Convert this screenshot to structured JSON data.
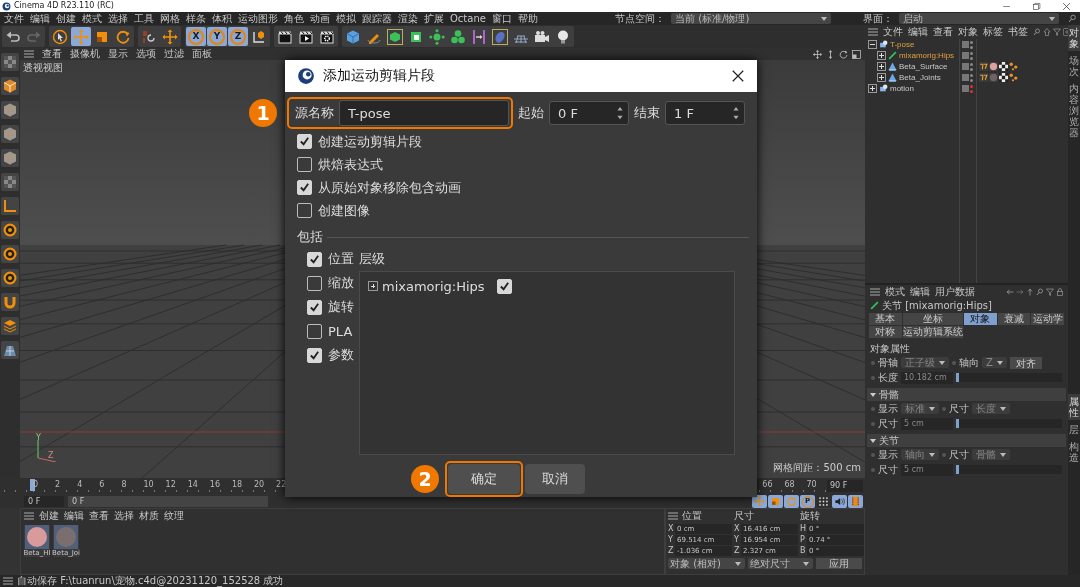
{
  "window": {
    "title": "Cinema 4D R23.110 (RC)"
  },
  "menu_bar": {
    "items": [
      "文件",
      "编辑",
      "创建",
      "模式",
      "选择",
      "工具",
      "网格",
      "样条",
      "体积",
      "运动图形",
      "角色",
      "动画",
      "模拟",
      "跟踪器",
      "渲染",
      "扩展",
      "Octane",
      "窗口",
      "帮助"
    ],
    "node_space_label": "节点空间：",
    "node_space_value": "当前 (标准/物理)",
    "layout_label": "界面：",
    "layout_value": "启动"
  },
  "toolbar": [
    [
      {
        "kind": "undo",
        "active": false
      },
      {
        "kind": "redo",
        "active": false
      }
    ],
    [
      {
        "kind": "pointer",
        "active": false
      },
      {
        "kind": "move",
        "active": true
      },
      {
        "kind": "scale",
        "active": false
      },
      {
        "kind": "rotate",
        "active": false
      }
    ],
    [
      {
        "kind": "snap",
        "active": false
      },
      {
        "kind": "move",
        "active": false
      }
    ],
    [
      {
        "kind": "axis",
        "label": "X",
        "active": true
      },
      {
        "kind": "axis",
        "label": "Y",
        "active": true
      },
      {
        "kind": "axis",
        "label": "Z",
        "active": true
      },
      {
        "kind": "coordsys",
        "active": false
      }
    ],
    [
      {
        "kind": "clapper",
        "active": false
      },
      {
        "kind": "render",
        "active": false
      },
      {
        "kind": "render_settings",
        "active": false
      }
    ],
    [
      {
        "kind": "cube_blue",
        "active": false
      },
      {
        "kind": "pen",
        "active": false
      },
      {
        "kind": "framed_cube",
        "active": false
      },
      {
        "kind": "cube_green",
        "active": false
      },
      {
        "kind": "cloner",
        "active": false
      },
      {
        "kind": "spheres",
        "active": false
      },
      {
        "kind": "deformer",
        "active": false
      },
      {
        "kind": "blob",
        "active": false
      },
      {
        "kind": "floor",
        "active": false
      },
      {
        "kind": "camera",
        "active": false
      },
      {
        "kind": "bulb",
        "active": false
      }
    ]
  ],
  "left_toolbar": [
    {
      "kind": "checker"
    },
    {
      "kind": "cube_orange"
    },
    {
      "kind": "cube_gray"
    },
    {
      "kind": "cube_gray"
    },
    {
      "kind": "cube_gray"
    },
    {
      "kind": "checker"
    },
    {
      "kind": "corner"
    },
    {
      "kind": "target"
    },
    {
      "kind": "target"
    },
    {
      "kind": "target"
    },
    {
      "kind": "magnet"
    },
    {
      "kind": "layers"
    },
    {
      "kind": "grid"
    }
  ],
  "viewport": {
    "menu": [
      "查看",
      "摄像机",
      "显示",
      "选项",
      "过滤",
      "面板"
    ],
    "label": "透视视图",
    "grid_spacing": "网格间距：500 cm",
    "axis_labels": [
      "Y",
      "Z"
    ]
  },
  "timeline": {
    "ruler": [
      "0",
      "2",
      "4",
      "6",
      "8",
      "10",
      "12",
      "14",
      "16",
      "18",
      "20",
      "22",
      "66",
      "68",
      "70"
    ],
    "end_field": "90 F",
    "current_field": "0 F",
    "range_field": "0 F"
  },
  "playback_tools": [
    {
      "kind": "move",
      "active": true
    },
    {
      "kind": "scale",
      "active": true
    },
    {
      "kind": "rotate",
      "active": true
    },
    {
      "kind": "axis",
      "label": "P",
      "active": true
    },
    {
      "kind": "dots",
      "active": false
    },
    {
      "kind": "speaker",
      "active": true
    },
    {
      "kind": "film",
      "active": true
    }
  ],
  "material_manager": {
    "menu": [
      "创建",
      "编辑",
      "查看",
      "选择",
      "材质",
      "纹理"
    ],
    "materials": [
      {
        "name": "Beta_HI",
        "color": "#d89a9a"
      },
      {
        "name": "Beta_Joi",
        "color": "#7a6e6e"
      }
    ]
  },
  "coordinates": {
    "headers": [
      "位置",
      "尺寸",
      "旋转"
    ],
    "rows": [
      {
        "axes": [
          "X",
          "X",
          "H"
        ],
        "values": [
          "0 cm",
          "16.416 cm",
          "0 °"
        ]
      },
      {
        "axes": [
          "Y",
          "Y",
          "P"
        ],
        "values": [
          "69.514 cm",
          "16.954 cm",
          "0.74 °"
        ]
      },
      {
        "axes": [
          "Z",
          "Z",
          "B"
        ],
        "values": [
          "-1.036 cm",
          "2.327 cm",
          "0 °"
        ]
      }
    ],
    "modes": [
      "对象 (相对)",
      "绝对尺寸"
    ],
    "apply": "应用"
  },
  "object_manager": {
    "menu": [
      "文件",
      "编辑",
      "查看",
      "对象",
      "标签",
      "书签"
    ],
    "objects": [
      {
        "name": "T-pose",
        "kind": "null",
        "selected": true,
        "expanded": true,
        "hidden": false,
        "children": [
          {
            "name": "mixamorig:Hips",
            "kind": "bone",
            "selected": true,
            "expanded": false,
            "hidden": false
          },
          {
            "name": "Beta_Surface",
            "kind": "mesh",
            "selected": false,
            "expanded": false,
            "hidden": false,
            "tags": [
              {
                "kind": "weight"
              },
              {
                "kind": "material",
                "color": "#e0a0a0"
              },
              {
                "kind": "texture"
              },
              {
                "kind": "dots"
              }
            ]
          },
          {
            "name": "Beta_Joints",
            "kind": "mesh",
            "selected": false,
            "expanded": false,
            "hidden": false,
            "tags": [
              {
                "kind": "weight"
              },
              {
                "kind": "material",
                "color": "#6e6262"
              },
              {
                "kind": "texture"
              },
              {
                "kind": "dots"
              }
            ]
          }
        ]
      },
      {
        "name": "motion",
        "kind": "null",
        "selected": false,
        "expanded": false,
        "hidden": true
      }
    ]
  },
  "attributes": {
    "menu": [
      "模式",
      "编辑",
      "用户数据"
    ],
    "title": "关节 [mixamorig:Hips]",
    "tabs": [
      {
        "label": "基本",
        "selected": false
      },
      {
        "label": "坐标",
        "selected": false
      },
      {
        "label": "对象",
        "selected": true
      },
      {
        "label": "衰减",
        "selected": false
      },
      {
        "label": "运动学",
        "selected": false
      },
      {
        "label": "对称",
        "selected": false
      },
      {
        "label": "运动剪辑系统",
        "selected": false
      }
    ],
    "groups": [
      {
        "title": "对象属性",
        "collapsible": false,
        "rows": [
          [
            {
              "kind": "dropdown",
              "label": "骨轴",
              "value": "正子级"
            },
            {
              "kind": "dropdown",
              "label": "轴向",
              "value": "Z"
            },
            {
              "kind": "button",
              "label": "对齐"
            }
          ],
          [
            {
              "kind": "slider",
              "label": "长度",
              "value": "10.182 cm",
              "level": 0
            }
          ]
        ]
      },
      {
        "title": "骨骼",
        "collapsible": true,
        "expanded": true,
        "rows": [
          [
            {
              "kind": "dropdown",
              "label": "显示",
              "value": "标准"
            },
            {
              "kind": "dropdown",
              "label": "尺寸",
              "value": "长度"
            }
          ],
          [
            {
              "kind": "slider",
              "label": "尺寸",
              "value": "5 cm",
              "level": 0
            }
          ]
        ]
      },
      {
        "title": "关节",
        "collapsible": true,
        "expanded": true,
        "rows": [
          [
            {
              "kind": "dropdown",
              "label": "显示",
              "value": "轴向"
            },
            {
              "kind": "dropdown",
              "label": "尺寸",
              "value": "骨骼"
            }
          ],
          [
            {
              "kind": "slider",
              "label": "尺寸",
              "value": "5 cm",
              "level": 0
            }
          ]
        ]
      }
    ]
  },
  "side_tabs_top": [
    {
      "label": "对象",
      "selected": true
    },
    {
      "label": "场次",
      "selected": false
    },
    {
      "label": "内容浏览器",
      "selected": false
    }
  ],
  "side_tabs_bottom": [
    {
      "label": "属性",
      "selected": true
    },
    {
      "label": "层",
      "selected": false
    },
    {
      "label": "构造",
      "selected": false
    }
  ],
  "status_bar": "自动保存 F:\\tuanrun\\宠物.c4d@20231120_152528 成功",
  "dialog": {
    "title": "添加运动剪辑片段",
    "source_label": "源名称",
    "source_value": "T-pose",
    "source_callout": "1",
    "start_label": "起始",
    "start_value": "0 F",
    "end_label": "结束",
    "end_value": "1 F",
    "options": [
      {
        "label": "创建运动剪辑片段",
        "checked": true
      },
      {
        "label": "烘焙表达式",
        "checked": false
      },
      {
        "label": "从原始对象移除包含动画",
        "checked": true
      },
      {
        "label": "创建图像",
        "checked": false
      }
    ],
    "include_title": "包括",
    "include": [
      {
        "label": "位置",
        "checked": true
      },
      {
        "label": "缩放",
        "checked": false
      },
      {
        "label": "旋转",
        "checked": true
      },
      {
        "label": "PLA",
        "checked": false
      },
      {
        "label": "参数",
        "checked": true
      }
    ],
    "hierarchy_label": "层级",
    "hierarchy": [
      {
        "name": "mixamorig:Hips",
        "checked": true,
        "expanded": false
      }
    ],
    "buttons": [
      {
        "label": "确定",
        "callout": "2"
      },
      {
        "label": "取消"
      }
    ]
  }
}
